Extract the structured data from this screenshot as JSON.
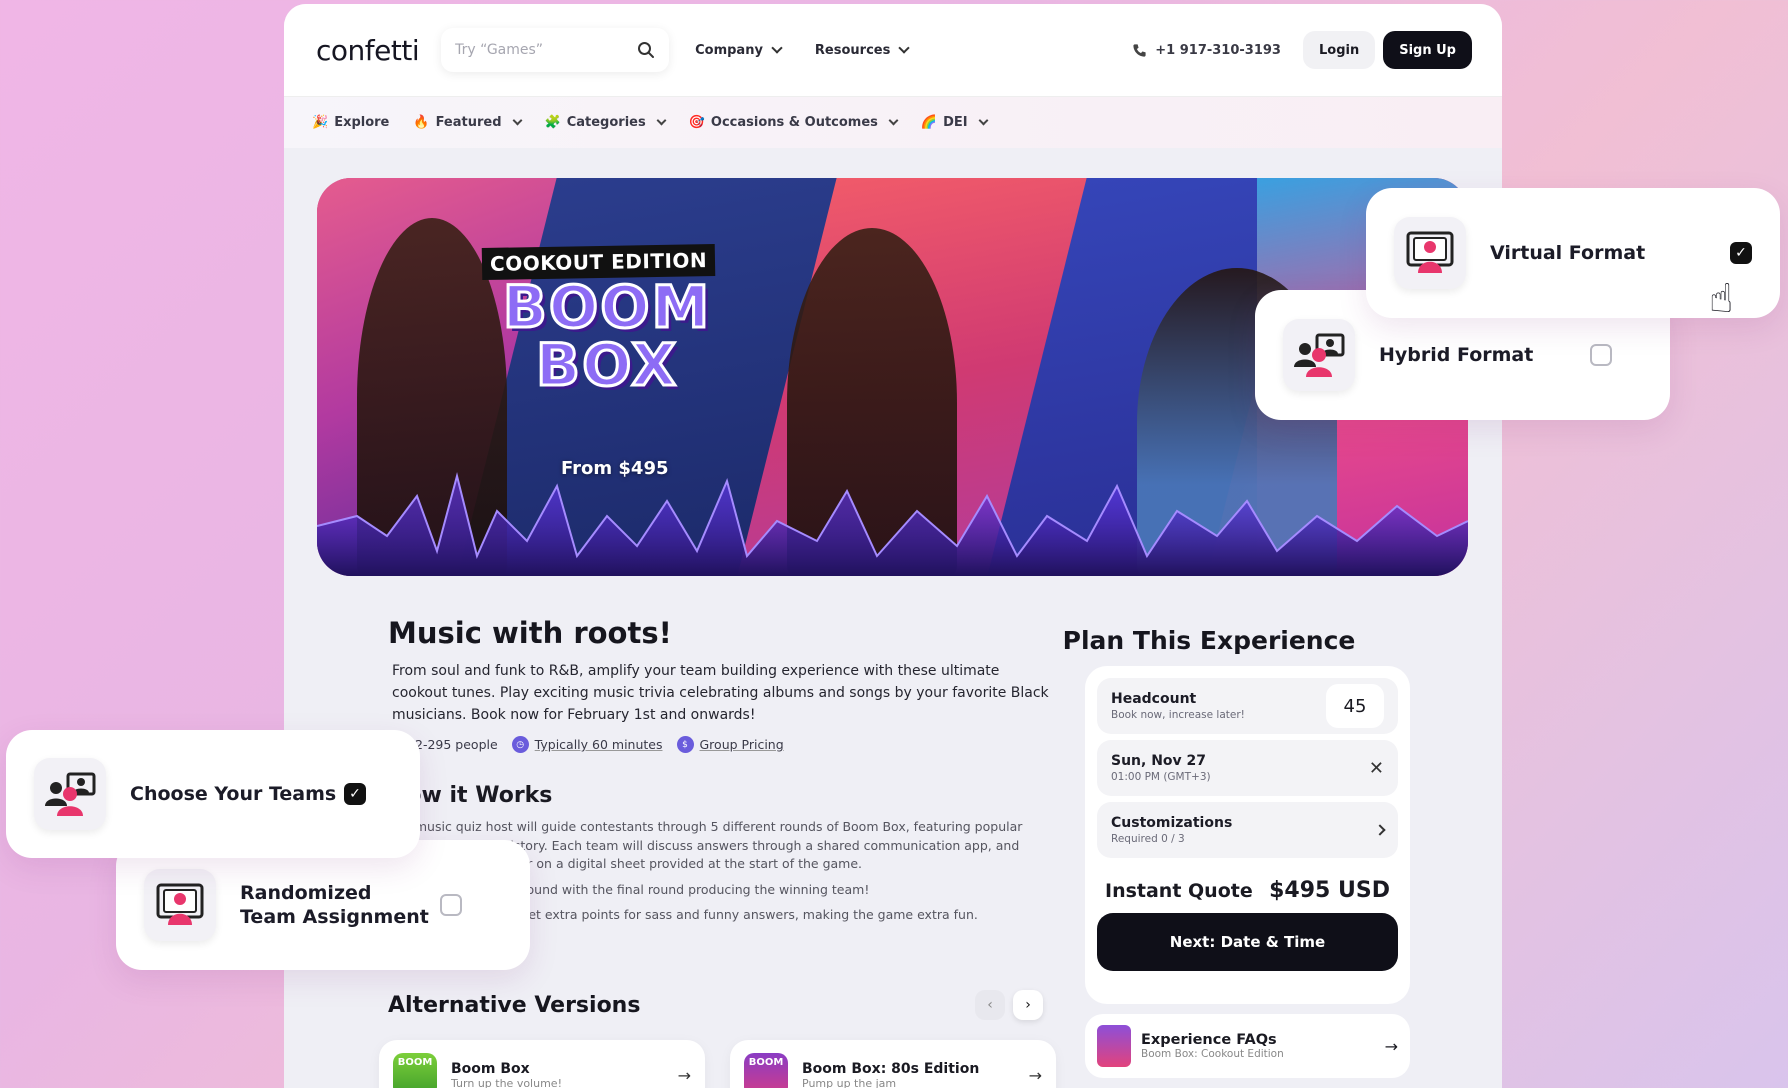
{
  "header": {
    "logo": "confetti",
    "search_placeholder": "Try “Games”",
    "nav": [
      {
        "label": "Company"
      },
      {
        "label": "Resources"
      }
    ],
    "phone": "+1 917-310-3193",
    "login": "Login",
    "signup": "Sign Up"
  },
  "subnav": [
    {
      "emoji": "🎉",
      "label": "Explore",
      "dropdown": false
    },
    {
      "emoji": "🔥",
      "label": "Featured",
      "dropdown": true
    },
    {
      "emoji": "🧩",
      "label": "Categories",
      "dropdown": true
    },
    {
      "emoji": "🎯",
      "label": "Occasions & Outcomes",
      "dropdown": true
    },
    {
      "emoji": "🌈",
      "label": "DEI",
      "dropdown": true
    }
  ],
  "hero": {
    "tag": "COOKOUT EDITION",
    "word1": "BOOM",
    "word2": "BOX",
    "price": "From $495"
  },
  "main": {
    "title": "Music with roots!",
    "description": "From soul and funk to R&B, amplify your team building experience with these ultimate cookout tunes. Play exciting music trivia celebrating albums and songs by your favorite Black musicians. Book now for February 1st and onwards!",
    "meta": [
      {
        "icon": "people-icon",
        "text": "2-295 people"
      },
      {
        "icon": "clock-icon",
        "text": "Typically 60 minutes"
      },
      {
        "icon": "pricing-icon",
        "text": "Group Pricing"
      }
    ],
    "how_title": "How it Works",
    "how_paragraphs": [
      "Our music quiz host will guide contestants through 5 different rounds of Boom Box, featuring popular music throughout history. Each team will discuss answers through a shared communication app, and record the final answer on a digital sheet provided at the start of the game.",
      "Points between each round with the final round producing the winning team!",
      "Bonus points. Teams get extra points for sass and funny answers, making the game extra fun."
    ],
    "alt_title": "Alternative Versions",
    "alt_cards": [
      {
        "thumb_text": "BOOM",
        "title": "Boom Box",
        "subtitle": "Turn up the volume!"
      },
      {
        "thumb_text": "BOOM",
        "title": "Boom Box: 80s Edition",
        "subtitle": "Pump up the jam"
      }
    ]
  },
  "plan": {
    "title": "Plan This Experience",
    "headcount_label": "Headcount",
    "headcount_sub": "Book now, increase later!",
    "headcount_value": "45",
    "date_label": "Sun, Nov 27",
    "date_sub": "01:00 PM (GMT+3)",
    "custom_label": "Customizations",
    "custom_sub": "Required 0 / 3",
    "quote_label": "Instant Quote",
    "quote_value": "$495 USD",
    "next_button": "Next: Date & Time",
    "faq_title": "Experience FAQs",
    "faq_sub": "Boom Box: Cookout Edition"
  },
  "floating": {
    "virtual": {
      "label": "Virtual Format",
      "checked": true
    },
    "hybrid": {
      "label": "Hybrid Format",
      "checked": false
    },
    "teams": {
      "label": "Choose Your Teams",
      "checked": true
    },
    "random": {
      "label1": "Randomized",
      "label2": "Team Assignment",
      "checked": false
    }
  },
  "colors": {
    "accent_pink": "#e8366c",
    "dark": "#0f0f18",
    "purple": "#6a5cdc"
  }
}
